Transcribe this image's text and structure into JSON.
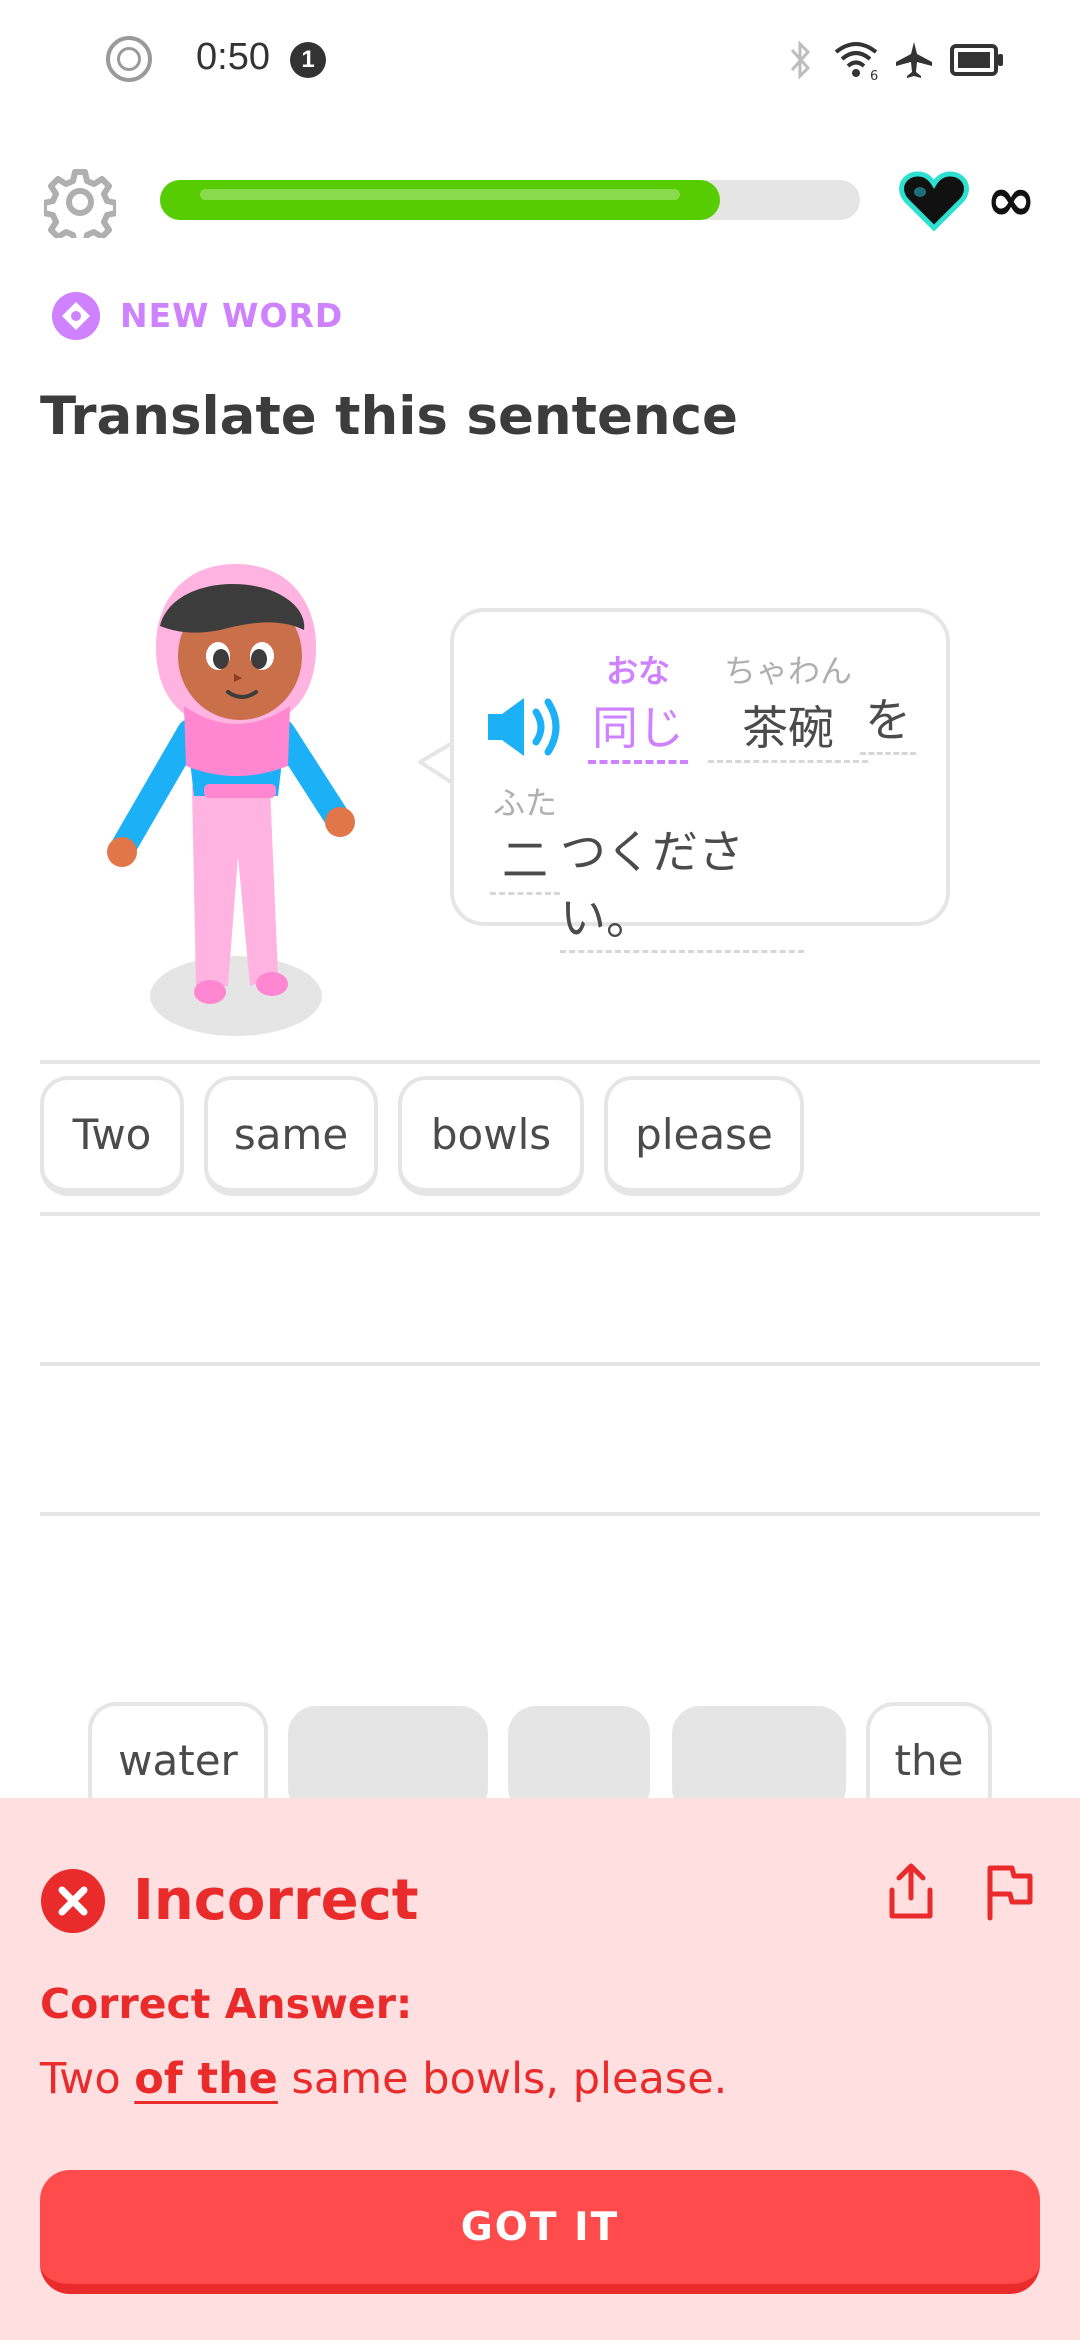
{
  "status_bar": {
    "time": "0:50",
    "notification_count": "1"
  },
  "header": {
    "progress": 0.8,
    "hearts": "∞"
  },
  "lesson": {
    "tag": "NEW WORD",
    "prompt": "Translate this sentence",
    "sentence": {
      "line1": [
        {
          "furigana": "おな",
          "text": "同じ",
          "highlight": true
        },
        {
          "furigana": "ちゃわん",
          "text": "茶碗",
          "highlight": false
        },
        {
          "furigana": "",
          "text": "を",
          "highlight": false
        }
      ],
      "line2": [
        {
          "furigana": "ふた",
          "text": "二",
          "highlight": false
        },
        {
          "furigana": "",
          "text": "つください。",
          "highlight": false
        }
      ]
    }
  },
  "answer_words": [
    "Two",
    "same",
    "bowls",
    "please"
  ],
  "word_bank": [
    "water",
    "",
    "",
    "",
    "the"
  ],
  "feedback": {
    "status": "Incorrect",
    "correct_label": "Correct Answer:",
    "answer_before": "Two ",
    "answer_highlight": "of the",
    "answer_after": " same bowls, please.",
    "button": "GOT IT"
  },
  "colors": {
    "accent_green": "#58cc02",
    "new_word_purple": "#ce82ff",
    "error_red": "#ea2b2b",
    "error_bg": "#ffdfe0",
    "speaker_blue": "#1cb0f6"
  }
}
